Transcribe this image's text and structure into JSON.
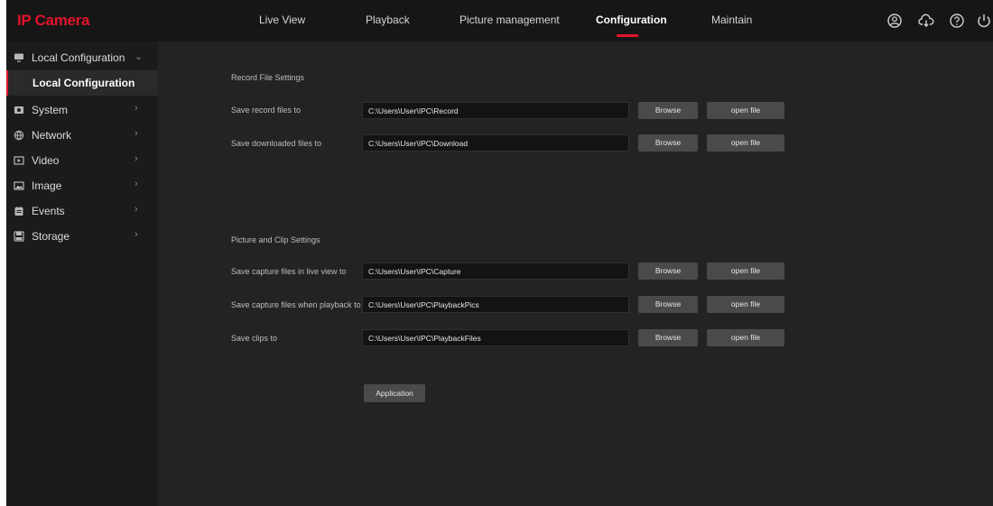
{
  "app": {
    "title": "IP Camera",
    "accent_color": "#e3132b"
  },
  "nav": {
    "items": [
      {
        "label": "Live View"
      },
      {
        "label": "Playback"
      },
      {
        "label": "Picture management"
      },
      {
        "label": "Configuration",
        "active": true
      },
      {
        "label": "Maintain"
      }
    ]
  },
  "top_icons": [
    "user-icon",
    "cloud-icon",
    "help-icon",
    "power-icon"
  ],
  "sidebar": {
    "items": [
      {
        "label": "Local Configuration",
        "icon": "monitor-icon",
        "expanded": true
      },
      {
        "label": "System",
        "icon": "system-icon"
      },
      {
        "label": "Network",
        "icon": "network-icon"
      },
      {
        "label": "Video",
        "icon": "video-icon"
      },
      {
        "label": "Image",
        "icon": "image-icon"
      },
      {
        "label": "Events",
        "icon": "events-icon"
      },
      {
        "label": "Storage",
        "icon": "storage-icon"
      }
    ],
    "sub_item": {
      "label": "Local Configuration",
      "selected": true
    }
  },
  "main": {
    "record_section": {
      "title": "Record File Settings",
      "rows": [
        {
          "label": "Save record files to",
          "value": "C:\\Users\\User\\IPC\\Record"
        },
        {
          "label": "Save downloaded files to",
          "value": "C:\\Users\\User\\IPC\\Download"
        }
      ]
    },
    "picture_section": {
      "title": "Picture and Clip Settings",
      "rows": [
        {
          "label": "Save capture files in live view to",
          "value": "C:\\Users\\User\\IPC\\Capture"
        },
        {
          "label": "Save capture files when playback to",
          "value": "C:\\Users\\User\\IPC\\PlaybackPics"
        },
        {
          "label": "Save clips to",
          "value": "C:\\Users\\User\\IPC\\PlaybackFiles"
        }
      ]
    },
    "browse_label": "Browse",
    "open_label": "open file",
    "apply_label": "Application"
  }
}
